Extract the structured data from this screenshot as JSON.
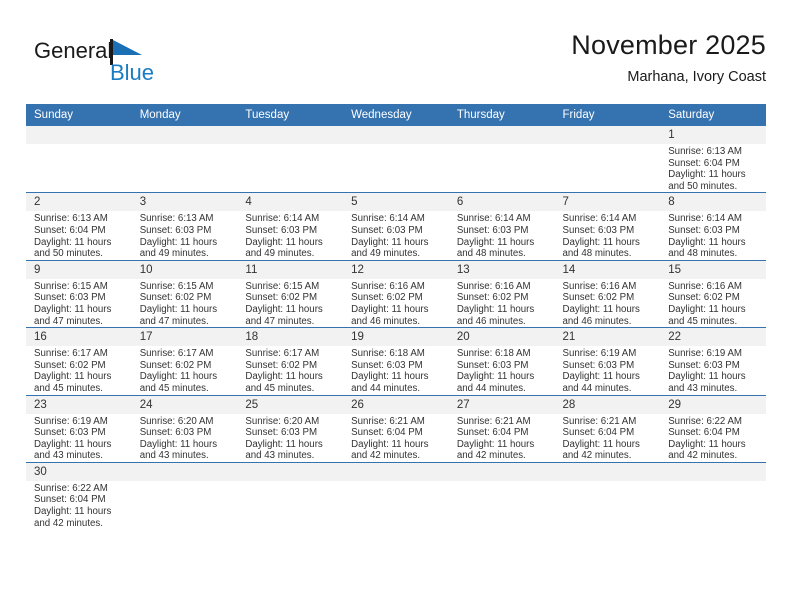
{
  "brand": {
    "name_line1": "General",
    "name_line2": "Blue",
    "logo_icon": "blue-flag-triangle-icon",
    "color_dark": "#1a1a1a",
    "color_blue": "#1a7dc4"
  },
  "header": {
    "title": "November 2025",
    "subtitle": "Marhana, Ivory Coast"
  },
  "theme": {
    "header_blue": "#3572b0",
    "daynum_bg": "#f2f2f2",
    "text": "#333333"
  },
  "calendar": {
    "weekday_headers": [
      "Sunday",
      "Monday",
      "Tuesday",
      "Wednesday",
      "Thursday",
      "Friday",
      "Saturday"
    ],
    "weeks": [
      [
        {
          "day": "",
          "lines": []
        },
        {
          "day": "",
          "lines": []
        },
        {
          "day": "",
          "lines": []
        },
        {
          "day": "",
          "lines": []
        },
        {
          "day": "",
          "lines": []
        },
        {
          "day": "",
          "lines": []
        },
        {
          "day": "1",
          "lines": [
            "Sunrise: 6:13 AM",
            "Sunset: 6:04 PM",
            "Daylight: 11 hours",
            "and 50 minutes."
          ]
        }
      ],
      [
        {
          "day": "2",
          "lines": [
            "Sunrise: 6:13 AM",
            "Sunset: 6:04 PM",
            "Daylight: 11 hours",
            "and 50 minutes."
          ]
        },
        {
          "day": "3",
          "lines": [
            "Sunrise: 6:13 AM",
            "Sunset: 6:03 PM",
            "Daylight: 11 hours",
            "and 49 minutes."
          ]
        },
        {
          "day": "4",
          "lines": [
            "Sunrise: 6:14 AM",
            "Sunset: 6:03 PM",
            "Daylight: 11 hours",
            "and 49 minutes."
          ]
        },
        {
          "day": "5",
          "lines": [
            "Sunrise: 6:14 AM",
            "Sunset: 6:03 PM",
            "Daylight: 11 hours",
            "and 49 minutes."
          ]
        },
        {
          "day": "6",
          "lines": [
            "Sunrise: 6:14 AM",
            "Sunset: 6:03 PM",
            "Daylight: 11 hours",
            "and 48 minutes."
          ]
        },
        {
          "day": "7",
          "lines": [
            "Sunrise: 6:14 AM",
            "Sunset: 6:03 PM",
            "Daylight: 11 hours",
            "and 48 minutes."
          ]
        },
        {
          "day": "8",
          "lines": [
            "Sunrise: 6:14 AM",
            "Sunset: 6:03 PM",
            "Daylight: 11 hours",
            "and 48 minutes."
          ]
        }
      ],
      [
        {
          "day": "9",
          "lines": [
            "Sunrise: 6:15 AM",
            "Sunset: 6:03 PM",
            "Daylight: 11 hours",
            "and 47 minutes."
          ]
        },
        {
          "day": "10",
          "lines": [
            "Sunrise: 6:15 AM",
            "Sunset: 6:02 PM",
            "Daylight: 11 hours",
            "and 47 minutes."
          ]
        },
        {
          "day": "11",
          "lines": [
            "Sunrise: 6:15 AM",
            "Sunset: 6:02 PM",
            "Daylight: 11 hours",
            "and 47 minutes."
          ]
        },
        {
          "day": "12",
          "lines": [
            "Sunrise: 6:16 AM",
            "Sunset: 6:02 PM",
            "Daylight: 11 hours",
            "and 46 minutes."
          ]
        },
        {
          "day": "13",
          "lines": [
            "Sunrise: 6:16 AM",
            "Sunset: 6:02 PM",
            "Daylight: 11 hours",
            "and 46 minutes."
          ]
        },
        {
          "day": "14",
          "lines": [
            "Sunrise: 6:16 AM",
            "Sunset: 6:02 PM",
            "Daylight: 11 hours",
            "and 46 minutes."
          ]
        },
        {
          "day": "15",
          "lines": [
            "Sunrise: 6:16 AM",
            "Sunset: 6:02 PM",
            "Daylight: 11 hours",
            "and 45 minutes."
          ]
        }
      ],
      [
        {
          "day": "16",
          "lines": [
            "Sunrise: 6:17 AM",
            "Sunset: 6:02 PM",
            "Daylight: 11 hours",
            "and 45 minutes."
          ]
        },
        {
          "day": "17",
          "lines": [
            "Sunrise: 6:17 AM",
            "Sunset: 6:02 PM",
            "Daylight: 11 hours",
            "and 45 minutes."
          ]
        },
        {
          "day": "18",
          "lines": [
            "Sunrise: 6:17 AM",
            "Sunset: 6:02 PM",
            "Daylight: 11 hours",
            "and 45 minutes."
          ]
        },
        {
          "day": "19",
          "lines": [
            "Sunrise: 6:18 AM",
            "Sunset: 6:03 PM",
            "Daylight: 11 hours",
            "and 44 minutes."
          ]
        },
        {
          "day": "20",
          "lines": [
            "Sunrise: 6:18 AM",
            "Sunset: 6:03 PM",
            "Daylight: 11 hours",
            "and 44 minutes."
          ]
        },
        {
          "day": "21",
          "lines": [
            "Sunrise: 6:19 AM",
            "Sunset: 6:03 PM",
            "Daylight: 11 hours",
            "and 44 minutes."
          ]
        },
        {
          "day": "22",
          "lines": [
            "Sunrise: 6:19 AM",
            "Sunset: 6:03 PM",
            "Daylight: 11 hours",
            "and 43 minutes."
          ]
        }
      ],
      [
        {
          "day": "23",
          "lines": [
            "Sunrise: 6:19 AM",
            "Sunset: 6:03 PM",
            "Daylight: 11 hours",
            "and 43 minutes."
          ]
        },
        {
          "day": "24",
          "lines": [
            "Sunrise: 6:20 AM",
            "Sunset: 6:03 PM",
            "Daylight: 11 hours",
            "and 43 minutes."
          ]
        },
        {
          "day": "25",
          "lines": [
            "Sunrise: 6:20 AM",
            "Sunset: 6:03 PM",
            "Daylight: 11 hours",
            "and 43 minutes."
          ]
        },
        {
          "day": "26",
          "lines": [
            "Sunrise: 6:21 AM",
            "Sunset: 6:04 PM",
            "Daylight: 11 hours",
            "and 42 minutes."
          ]
        },
        {
          "day": "27",
          "lines": [
            "Sunrise: 6:21 AM",
            "Sunset: 6:04 PM",
            "Daylight: 11 hours",
            "and 42 minutes."
          ]
        },
        {
          "day": "28",
          "lines": [
            "Sunrise: 6:21 AM",
            "Sunset: 6:04 PM",
            "Daylight: 11 hours",
            "and 42 minutes."
          ]
        },
        {
          "day": "29",
          "lines": [
            "Sunrise: 6:22 AM",
            "Sunset: 6:04 PM",
            "Daylight: 11 hours",
            "and 42 minutes."
          ]
        }
      ],
      [
        {
          "day": "30",
          "lines": [
            "Sunrise: 6:22 AM",
            "Sunset: 6:04 PM",
            "Daylight: 11 hours",
            "and 42 minutes."
          ]
        },
        {
          "day": "",
          "lines": []
        },
        {
          "day": "",
          "lines": []
        },
        {
          "day": "",
          "lines": []
        },
        {
          "day": "",
          "lines": []
        },
        {
          "day": "",
          "lines": []
        },
        {
          "day": "",
          "lines": []
        }
      ]
    ]
  }
}
